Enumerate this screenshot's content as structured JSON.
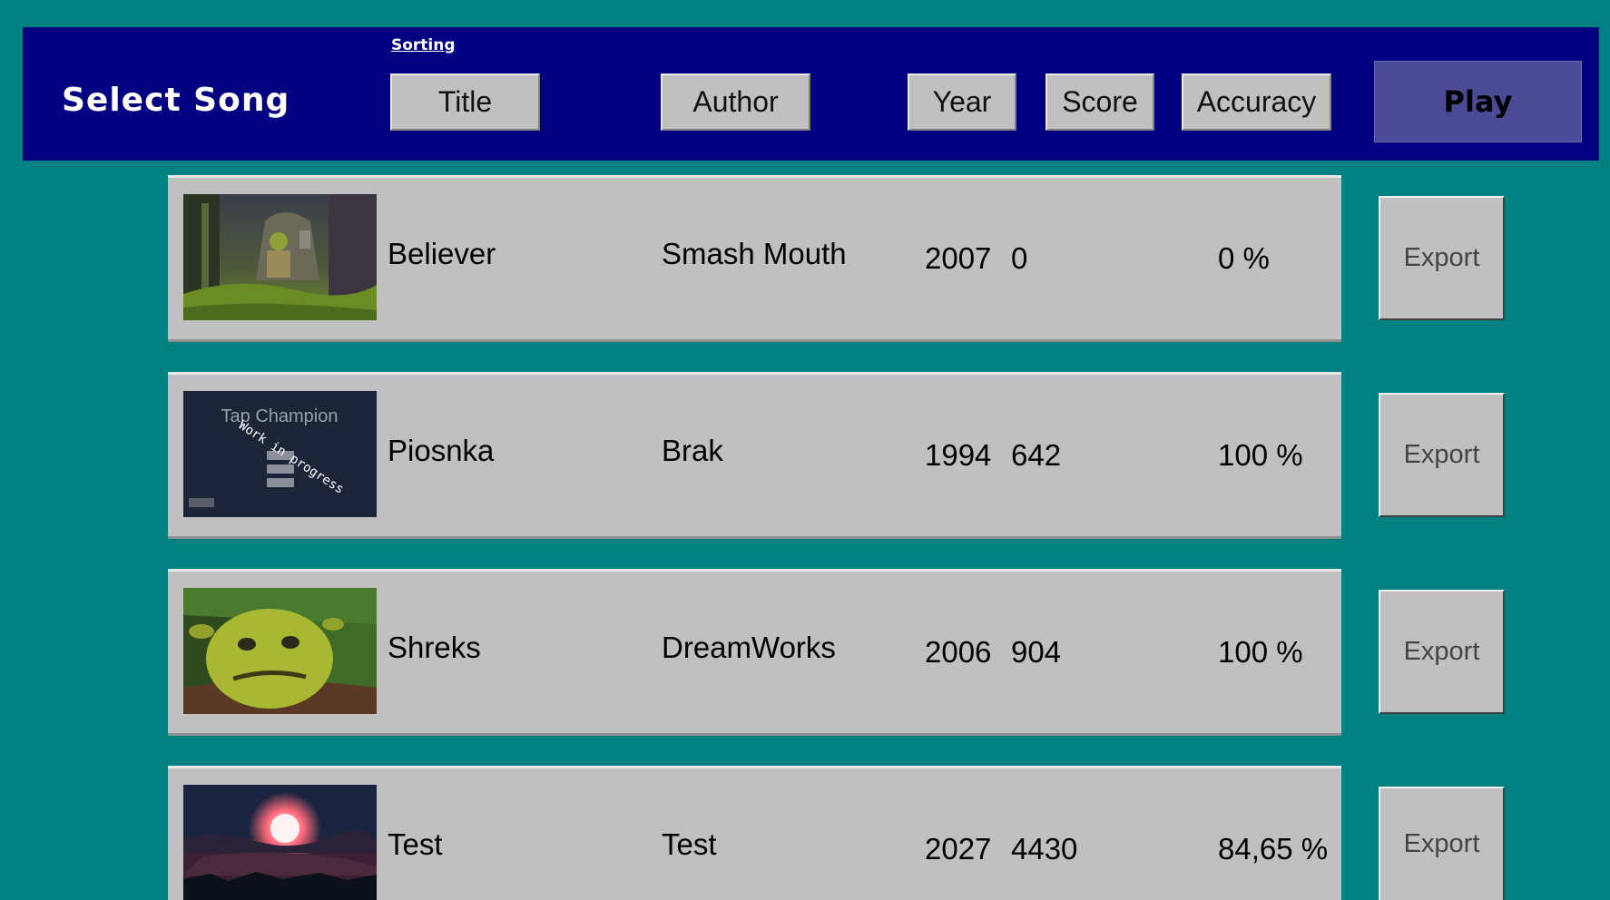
{
  "header": {
    "title": "Select Song",
    "sorting_label": "Sorting",
    "sort_buttons": [
      "Title",
      "Author",
      "Year",
      "Score",
      "Accuracy"
    ],
    "play_label": "Play"
  },
  "songs": [
    {
      "title": "Believer",
      "author": "Smash Mouth",
      "year": "2007",
      "score": "0",
      "accuracy": "0 %",
      "export_label": "Export",
      "thumbnail": "shrek-swamp-image"
    },
    {
      "title": "Piosnka",
      "author": "Brak",
      "year": "1994",
      "score": "642",
      "accuracy": "100 %",
      "export_label": "Export",
      "thumbnail": "tap-champion-wip-image",
      "thumb_title": "Tap Champion",
      "thumb_overlay": "Work in progress"
    },
    {
      "title": "Shreks",
      "author": "DreamWorks",
      "year": "2006",
      "score": "904",
      "accuracy": "100 %",
      "export_label": "Export",
      "thumbnail": "shrek-face-image"
    },
    {
      "title": "Test",
      "author": "Test",
      "year": "2027",
      "score": "4430",
      "accuracy": "84,65 %",
      "export_label": "Export",
      "thumbnail": "sunset-clouds-image"
    }
  ],
  "colors": {
    "background": "#008080",
    "header": "#000080",
    "row": "#c0c0c0",
    "play_button": "#4a4a95"
  }
}
